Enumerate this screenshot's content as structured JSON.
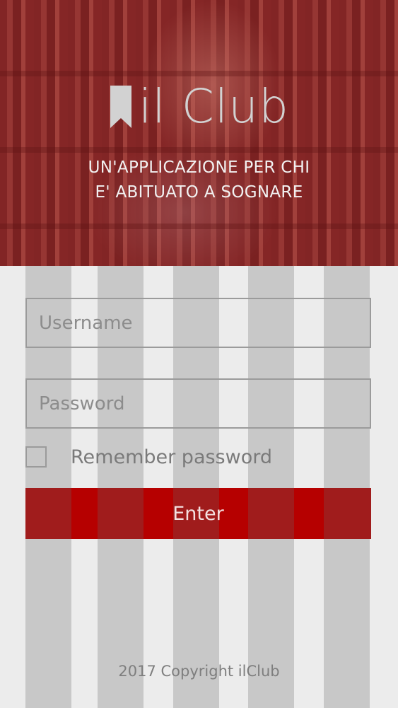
{
  "app": {
    "title": "il Club",
    "brand_icon": "bookmark-icon",
    "tagline": [
      "UN'APPLICAZIONE PER CHI",
      "E' ABITUATO A SOGNARE"
    ]
  },
  "login": {
    "username_placeholder": "Username",
    "username_value": "",
    "password_placeholder": "Password",
    "password_value": "",
    "remember_label": "Remember password",
    "remember_checked": false,
    "submit_label": "Enter"
  },
  "footer": {
    "copyright": "2017 Copyright ilClub"
  },
  "colors": {
    "accent": "#b60000",
    "background": "#ececec",
    "hero_tint": "#8b2a2a",
    "text_muted": "#8c8c8c"
  }
}
